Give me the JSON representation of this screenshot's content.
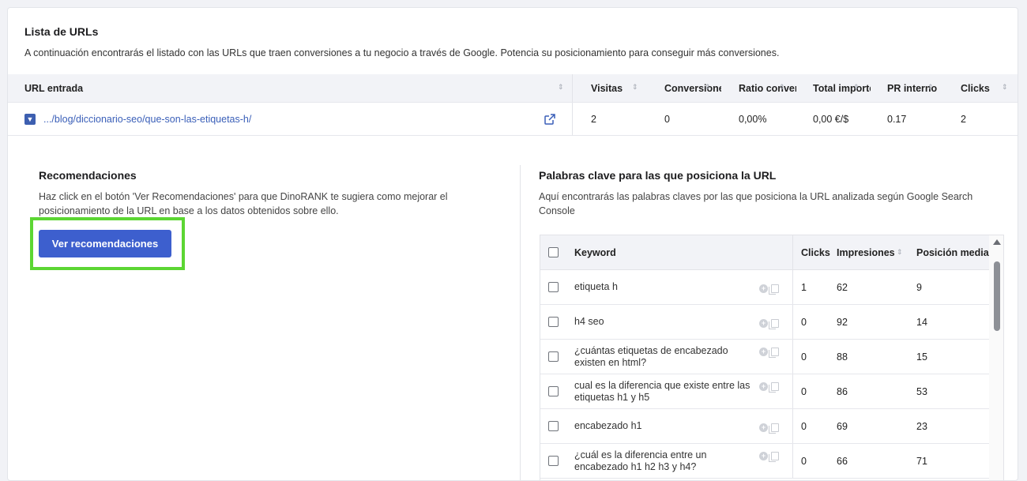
{
  "url_list": {
    "title": "Lista de URLs",
    "description": "A continuación encontrarás el listado con las URLs que traen conversiones a tu negocio a través de Google. Potencia su posicionamiento para conseguir más conversiones.",
    "columns": {
      "url": "URL entrada",
      "visits": "Visitas",
      "conversions": "Conversiones",
      "ratio": "Ratio conversión",
      "total": "Total importe",
      "pr": "PR interno",
      "clicks": "Clicks"
    },
    "row": {
      "url": ".../blog/diccionario-seo/que-son-las-etiquetas-h/",
      "visits": "2",
      "conversions": "0",
      "ratio": "0,00%",
      "total": "0,00 €/$",
      "pr": "0.17",
      "clicks": "2"
    }
  },
  "recommendations": {
    "title": "Recomendaciones",
    "description": "Haz click en el botón 'Ver Recomendaciones' para que DinoRANK te sugiera como mejorar el posicionamiento de la URL en base a los datos obtenidos sobre ello.",
    "button_label": "Ver recomendaciones"
  },
  "keywords": {
    "title": "Palabras clave para las que posiciona la URL",
    "description": "Aquí encontrarás las palabras claves por las que posiciona la URL analizada según Google Search Console",
    "columns": {
      "keyword": "Keyword",
      "clicks": "Clicks",
      "impressions": "Impresiones",
      "position": "Posición media"
    },
    "rows": [
      {
        "keyword": "etiqueta h",
        "clicks": "1",
        "impressions": "62",
        "position": "9"
      },
      {
        "keyword": "h4 seo",
        "clicks": "0",
        "impressions": "92",
        "position": "14"
      },
      {
        "keyword": "¿cuántas etiquetas de encabezado existen en html?",
        "clicks": "0",
        "impressions": "88",
        "position": "15"
      },
      {
        "keyword": "cual es la diferencia que existe entre las etiquetas h1 y h5",
        "clicks": "0",
        "impressions": "86",
        "position": "53"
      },
      {
        "keyword": "encabezado h1",
        "clicks": "0",
        "impressions": "69",
        "position": "23"
      },
      {
        "keyword": "¿cuál es la diferencia entre un encabezado h1 h2 h3 y h4?",
        "clicks": "0",
        "impressions": "66",
        "position": "71"
      }
    ]
  },
  "colors": {
    "accent": "#3d5fce",
    "link": "#3a5fb8",
    "highlight": "#5cd633"
  }
}
